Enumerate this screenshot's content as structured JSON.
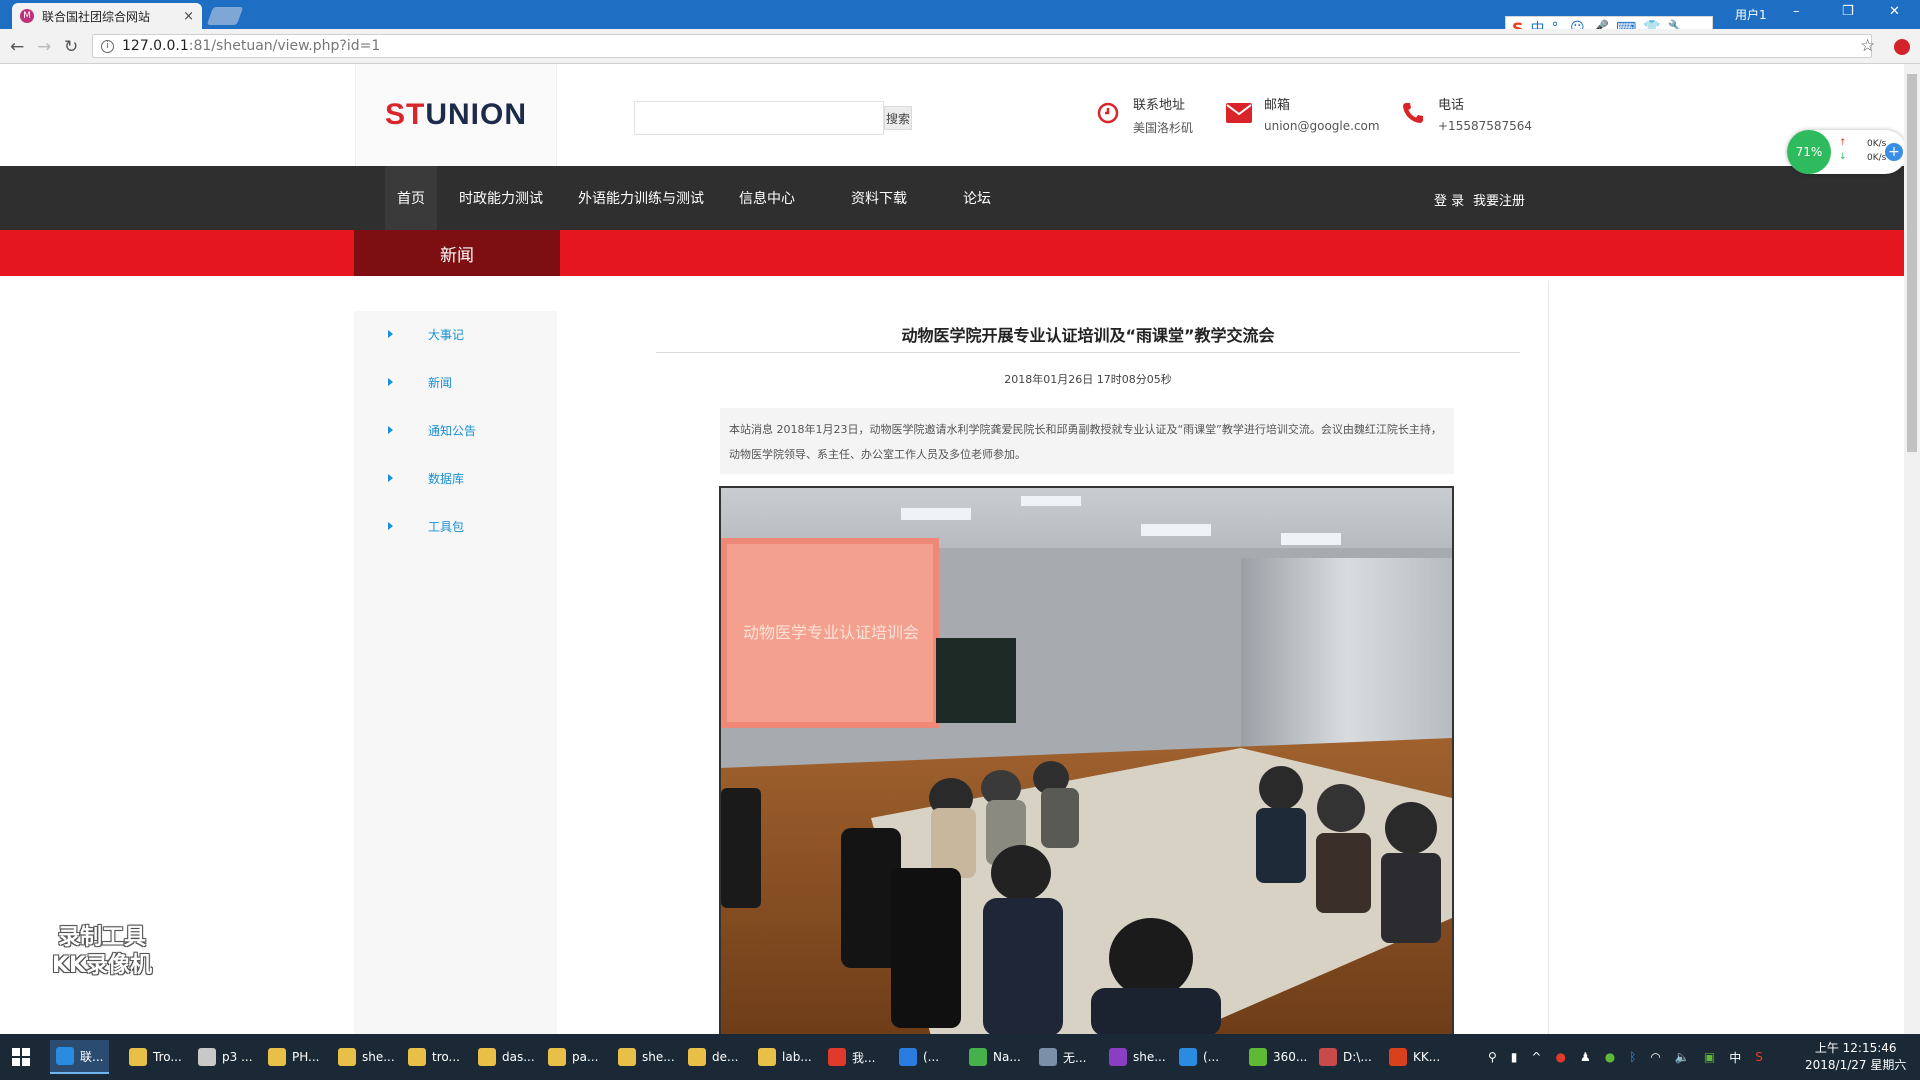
{
  "browser": {
    "tab_title": "联合国社团综合网站",
    "tab_close": "×",
    "favicon": "M",
    "user": "用户1",
    "url_host": "127.0.0.1",
    "url_rest": ":81/shetuan/view.php?id=1",
    "window_controls": [
      "–",
      "❐",
      "✕"
    ]
  },
  "ime": {
    "logo": "S",
    "items": [
      "中",
      "°,",
      "☺",
      "🎤",
      "⌨",
      "👕",
      "🔧"
    ]
  },
  "header": {
    "logo_red": "ST",
    "logo_dark": "UNION",
    "search_placeholder": "",
    "search_button": "搜索",
    "contacts": [
      {
        "label": "联系地址",
        "value": "美国洛杉矶",
        "icon": "clock-icon",
        "color": "#d9252a"
      },
      {
        "label": "邮箱",
        "value": "union@google.com",
        "icon": "mail-icon",
        "color": "#d9252a"
      },
      {
        "label": "电话",
        "value": "+15587587564",
        "icon": "phone-icon",
        "color": "#d9252a"
      }
    ]
  },
  "nav": {
    "items": [
      "首页",
      "时政能力测试",
      "外语能力训练与测试",
      "信息中心",
      "资料下载",
      "论坛"
    ],
    "login": "登 录",
    "register": "我要注册"
  },
  "speed_widget": {
    "percent": "71%",
    "up": "0K/s",
    "down": "0K/s",
    "plus": "+"
  },
  "section": {
    "title": "新闻"
  },
  "sidebar": {
    "items": [
      "大事记",
      "新闻",
      "通知公告",
      "数据库",
      "工具包"
    ]
  },
  "article": {
    "title": "动物医学院开展专业认证培训及“雨课堂”教学交流会",
    "date": "2018年01月26日 17时08分05秒",
    "summary": "本站消息 2018年1月23日，动物医学院邀请水利学院龚爱民院长和邱勇副教授就专业认证及“雨课堂”教学进行培训交流。会议由魏红江院长主持，动物医学院领导、系主任、办公室工作人员及多位老师参加。",
    "photo_slide_text": "动物医学专业认证培训会"
  },
  "watermark": {
    "line1": "录制工具",
    "line2": "KK录像机"
  },
  "taskbar": {
    "items": [
      {
        "label": "联...",
        "icon": "chrome-icon",
        "color": "#2a8be0",
        "active": true
      },
      {
        "label": "Tro...",
        "icon": "folder-icon",
        "color": "#e8c048"
      },
      {
        "label": "p3 ...",
        "icon": "drive-icon",
        "color": "#c8c8c8"
      },
      {
        "label": "PH...",
        "icon": "folder-icon",
        "color": "#e8c048"
      },
      {
        "label": "she...",
        "icon": "folder-icon",
        "color": "#e8c048"
      },
      {
        "label": "tro...",
        "icon": "folder-icon",
        "color": "#e8c048"
      },
      {
        "label": "das...",
        "icon": "folder-icon",
        "color": "#e8c048"
      },
      {
        "label": "pa...",
        "icon": "folder-icon",
        "color": "#e8c048"
      },
      {
        "label": "she...",
        "icon": "folder-icon",
        "color": "#e8c048"
      },
      {
        "label": "de...",
        "icon": "folder-icon",
        "color": "#e8c048"
      },
      {
        "label": "lab...",
        "icon": "folder-icon",
        "color": "#e8c048"
      },
      {
        "label": "我...",
        "icon": "weibo-icon",
        "color": "#e03a2c"
      },
      {
        "label": "(...",
        "icon": "wps-icon",
        "color": "#2b7ce0"
      },
      {
        "label": "Na...",
        "icon": "navicat-icon",
        "color": "#46b04a"
      },
      {
        "label": "无...",
        "icon": "app-icon",
        "color": "#7b8fa8"
      },
      {
        "label": "she...",
        "icon": "phpstorm-icon",
        "color": "#8a3ec2"
      },
      {
        "label": "(...",
        "icon": "browser-icon",
        "color": "#2a8be0"
      },
      {
        "label": "360...",
        "icon": "360-icon",
        "color": "#5fb935"
      },
      {
        "label": "D:\\...",
        "icon": "editor-icon",
        "color": "#c94a4a"
      },
      {
        "label": "KK...",
        "icon": "kk-icon",
        "color": "#d9401c"
      }
    ],
    "tray_ime": "中",
    "clock_time": "上午 12:15:46",
    "clock_date": "2018/1/27 星期六"
  }
}
